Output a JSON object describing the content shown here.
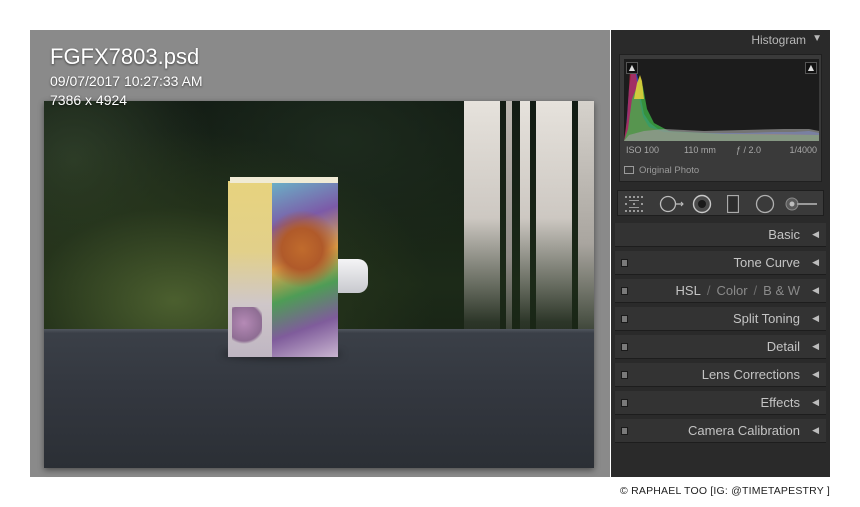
{
  "overlay": {
    "file_name": "FGFX7803.psd",
    "datetime": "09/07/2017 10:27:33 AM",
    "dimensions": "7386 x 4924"
  },
  "histogram": {
    "title": "Histogram",
    "collapse_icon": "triangle-down-icon",
    "exif": {
      "iso": "ISO 100",
      "focal_length": "110 mm",
      "aperture": "ƒ / 2.0",
      "shutter": "1/4000"
    },
    "original_photo_label": "Original Photo"
  },
  "tools": [
    {
      "name": "crop-overlay-icon"
    },
    {
      "name": "spot-removal-icon"
    },
    {
      "name": "red-eye-icon"
    },
    {
      "name": "graduated-filter-icon"
    },
    {
      "name": "radial-filter-icon"
    },
    {
      "name": "adjustment-brush-icon"
    }
  ],
  "sections": {
    "basic": "Basic",
    "tone_curve": "Tone Curve",
    "hsl": "HSL",
    "color": "Color",
    "bw": "B & W",
    "hsl_separator": "/",
    "split_toning": "Split Toning",
    "detail": "Detail",
    "lens_corrections": "Lens Corrections",
    "effects": "Effects",
    "camera_calibration": "Camera Calibration",
    "expand_icon": "triangle-left-icon"
  },
  "credit": "© RAPHAEL TOO [IG: @TIMETAPESTRY ]",
  "colors": {
    "panel_bg": "#2a2a2a",
    "section_bg": "#333333",
    "canvas_bg": "#8a8a8a",
    "text_light": "#c4c4c4"
  }
}
